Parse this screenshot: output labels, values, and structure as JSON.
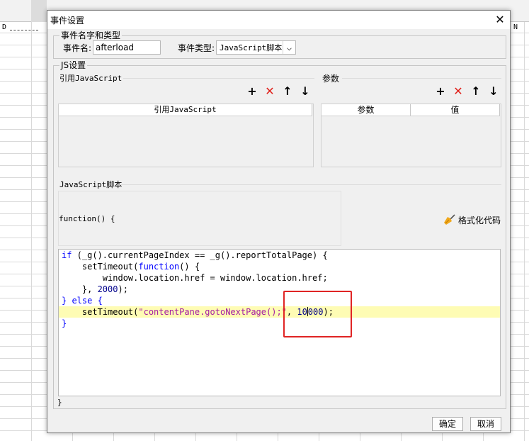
{
  "sheet": {
    "col_left": "D",
    "col_right": "N"
  },
  "dialog": {
    "title": "事件设置",
    "close_glyph": "✕"
  },
  "event_group": {
    "legend": "事件名字和类型",
    "name_label": "事件名:",
    "name_value": "afterload",
    "type_label": "事件类型:",
    "type_value": "JavaScript脚本",
    "chevron": "⌵"
  },
  "js_group": {
    "legend": "JS设置",
    "ref_title": "引用JavaScript",
    "params_title": "参数",
    "ref_table": {
      "header": "引用JavaScript"
    },
    "params_table": {
      "header_param": "参数",
      "header_value": "值"
    },
    "script_title": "JavaScript脚本",
    "function_open": "function() {",
    "format_code_label": "格式化代码",
    "function_close": "}",
    "toolbar": {
      "add": "+",
      "remove": "✕",
      "up": "↑",
      "down": "↓"
    }
  },
  "code": {
    "l1a": "if",
    "l1b": " (_g().currentPageIndex == _g().reportTotalPage) {",
    "l2a": "    setTimeout(",
    "l2b": "function",
    "l2c": "() {",
    "l3": "        window.location.href = window.location.href;",
    "l4a": "    }, ",
    "l4b": "2000",
    "l4c": ");",
    "l5a": "} ",
    "l5b": "else",
    "l5c": " {",
    "l6a": "    setTimeout(",
    "l6b": "\"contentPane.gotoNextPage();\"",
    "l6c": ", ",
    "l6d": "10",
    "l6e": "000",
    "l6f": ");",
    "l7": "}"
  },
  "buttons": {
    "ok": "确定",
    "cancel": "取消"
  }
}
